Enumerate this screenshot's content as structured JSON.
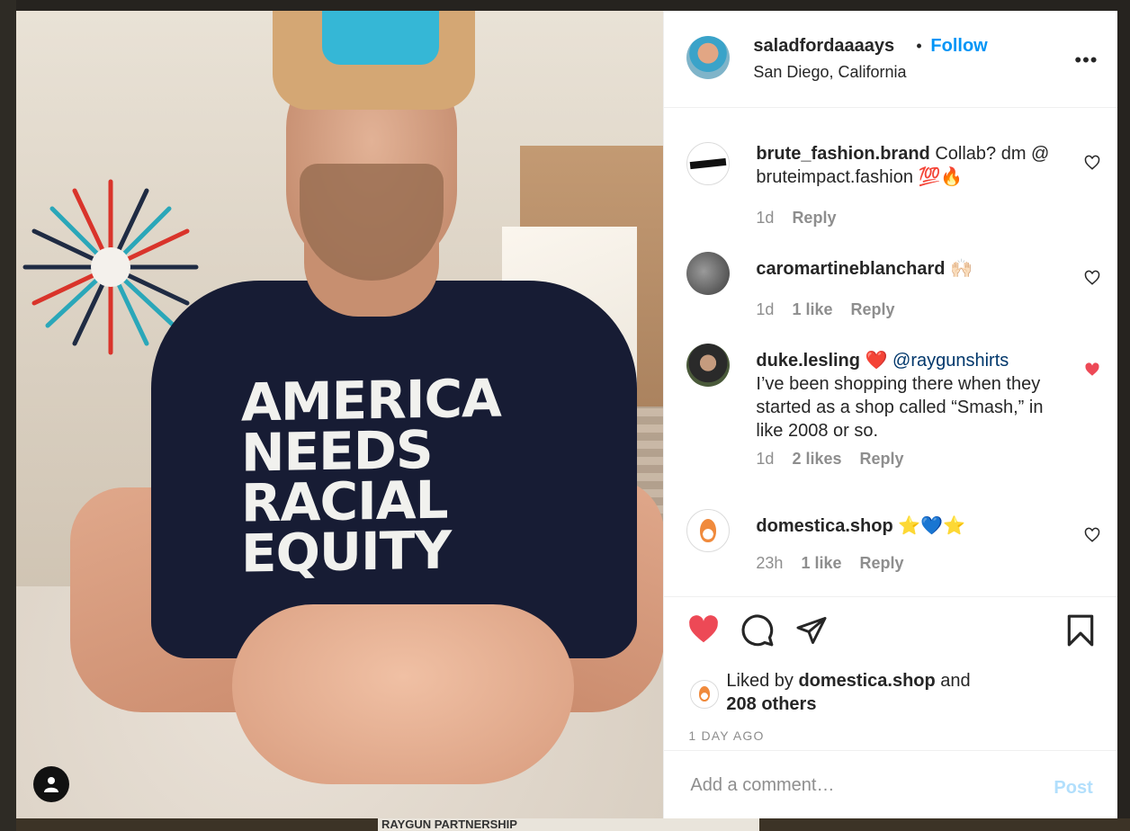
{
  "background": {
    "tile_colors": [
      "#3b3a35",
      "#6b5a3e",
      "#2f3c2a",
      "#8a6f4f",
      "#4d3b2b",
      "#d9c9a8",
      "#2b2b2b",
      "#5d6b4a"
    ],
    "caption_fragment": "RAYGUN PARTNERSHIP"
  },
  "photo": {
    "shirt_lines": [
      "AMERICA",
      "NEEDS",
      "RACIAL",
      "EQUITY"
    ],
    "profile_button_icon": "user-icon"
  },
  "post": {
    "username": "saladfordaaaays",
    "separator": "•",
    "follow_label": "Follow",
    "location": "San Diego, California",
    "more_icon": "more-options-icon",
    "more_glyph": "•••"
  },
  "comments": [
    {
      "username": "brute_fashion.brand",
      "text": "Collab? dm @ bruteimpact.fashion 💯🔥",
      "time": "1d",
      "likes": "",
      "reply": "Reply",
      "liked": false
    },
    {
      "username": "caromartineblanchard",
      "text": "🙌🏻",
      "time": "1d",
      "likes": "1 like",
      "reply": "Reply",
      "liked": false
    },
    {
      "username": "duke.lesling",
      "emoji": "❤️",
      "mention": "@raygunshirts",
      "text": "I’ve been shopping there when they started as a shop called “Smash,” in like 2008 or so.",
      "time": "1d",
      "likes": "2 likes",
      "reply": "Reply",
      "liked": true
    },
    {
      "username": "domestica.shop",
      "text": "⭐💙⭐",
      "time": "23h",
      "likes": "1 like",
      "reply": "Reply",
      "liked": false
    }
  ],
  "actions": {
    "like_icon": "heart-filled-icon",
    "comment_icon": "comment-icon",
    "share_icon": "share-icon",
    "save_icon": "bookmark-icon",
    "liked": true,
    "accent_color": "#ed4956",
    "liked_by_prefix": "Liked by",
    "liked_by_user": "domestica.shop",
    "liked_by_and": "and",
    "others": "208 others",
    "timestamp": "1 DAY AGO"
  },
  "add_comment": {
    "placeholder": "Add a comment…",
    "post_label": "Post",
    "post_color": "#b2dffc"
  }
}
